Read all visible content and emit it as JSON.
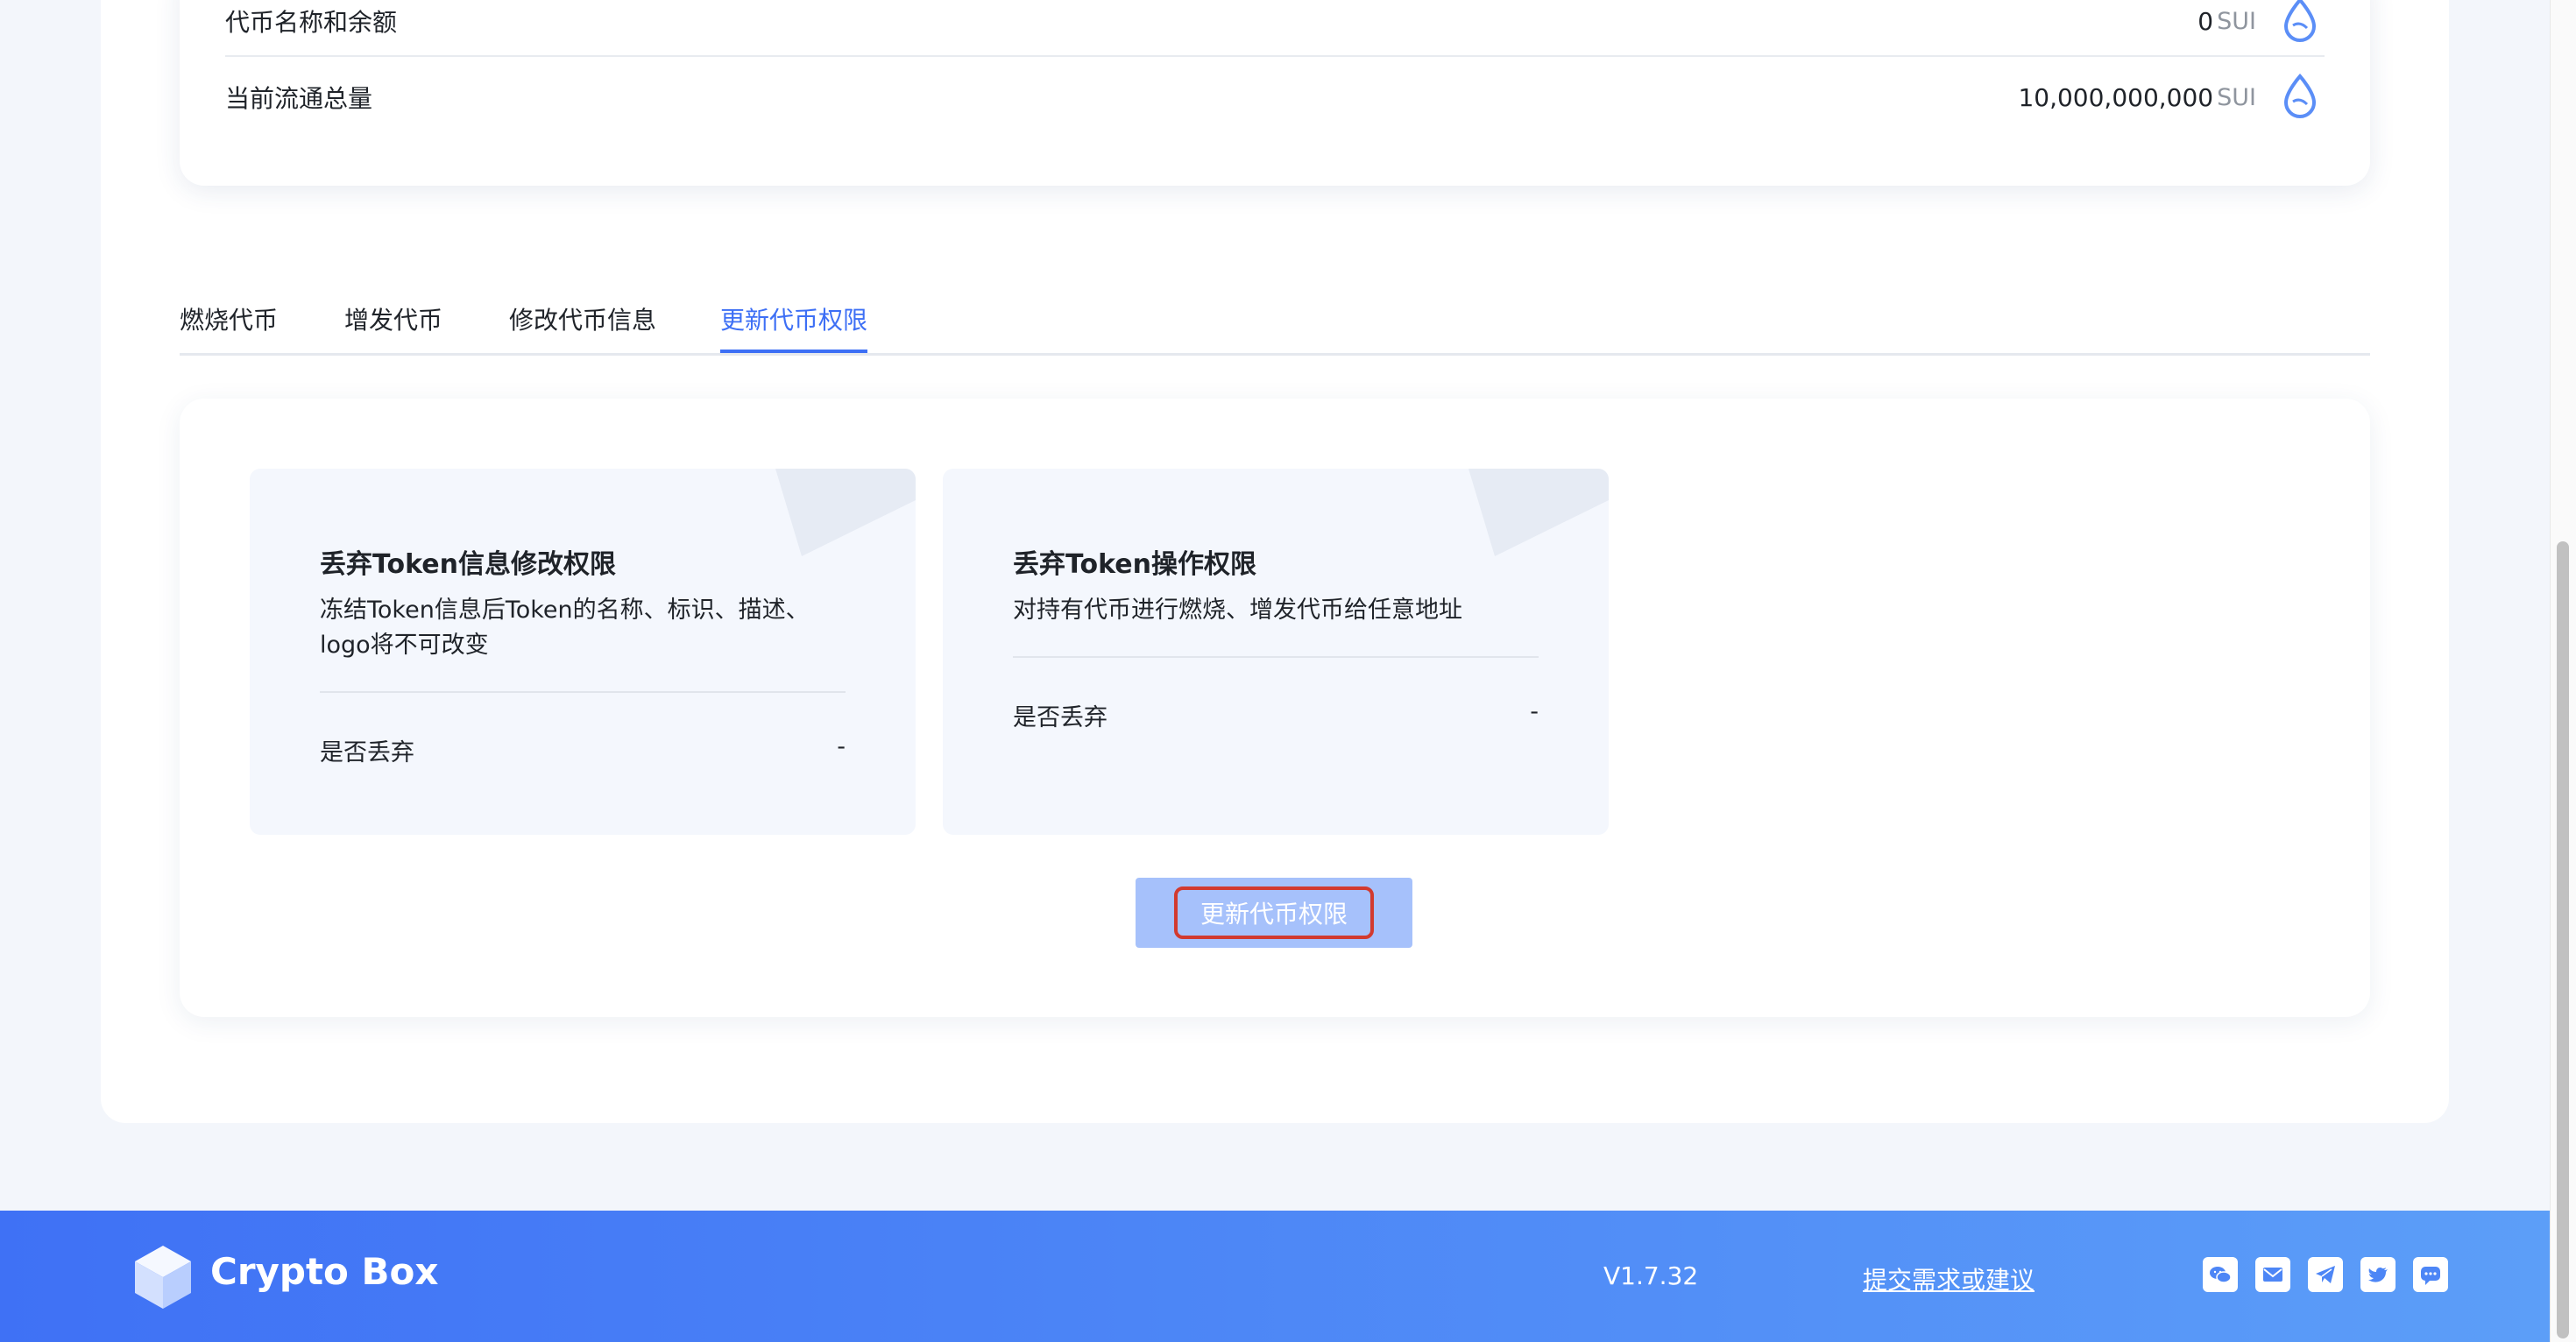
{
  "token_info": {
    "rows": [
      {
        "label": "代币名称和余额",
        "value": "0",
        "unit": "SUI",
        "icon": "sui-drop-icon"
      },
      {
        "label": "当前流通总量",
        "value": "10,000,000,000",
        "unit": "SUI",
        "icon": "sui-drop-icon"
      }
    ]
  },
  "tabs": [
    {
      "label": "燃烧代币",
      "active": false
    },
    {
      "label": "增发代币",
      "active": false
    },
    {
      "label": "修改代币信息",
      "active": false
    },
    {
      "label": "更新代币权限",
      "active": true
    }
  ],
  "permissions": {
    "cards": [
      {
        "title": "丢弃Token信息修改权限",
        "description": "冻结Token信息后Token的名称、标识、描述、logo将不可改变",
        "row_label": "是否丢弃",
        "row_value": "-"
      },
      {
        "title": "丢弃Token操作权限",
        "description": "对持有代币进行燃烧、增发代币给任意地址",
        "row_label": "是否丢弃",
        "row_value": "-"
      }
    ],
    "submit_label": "更新代币权限"
  },
  "footer": {
    "brand": "Crypto Box",
    "version": "V1.7.32",
    "feedback_link": "提交需求或建议",
    "social_icons": [
      "wechat-icon",
      "mail-icon",
      "telegram-icon",
      "twitter-icon",
      "chat-icon"
    ]
  },
  "colors": {
    "accent": "#3d6ff5",
    "button_disabled": "#a6c1fb",
    "highlight_border": "#d23a2f",
    "card_bg": "#f4f7fd"
  }
}
